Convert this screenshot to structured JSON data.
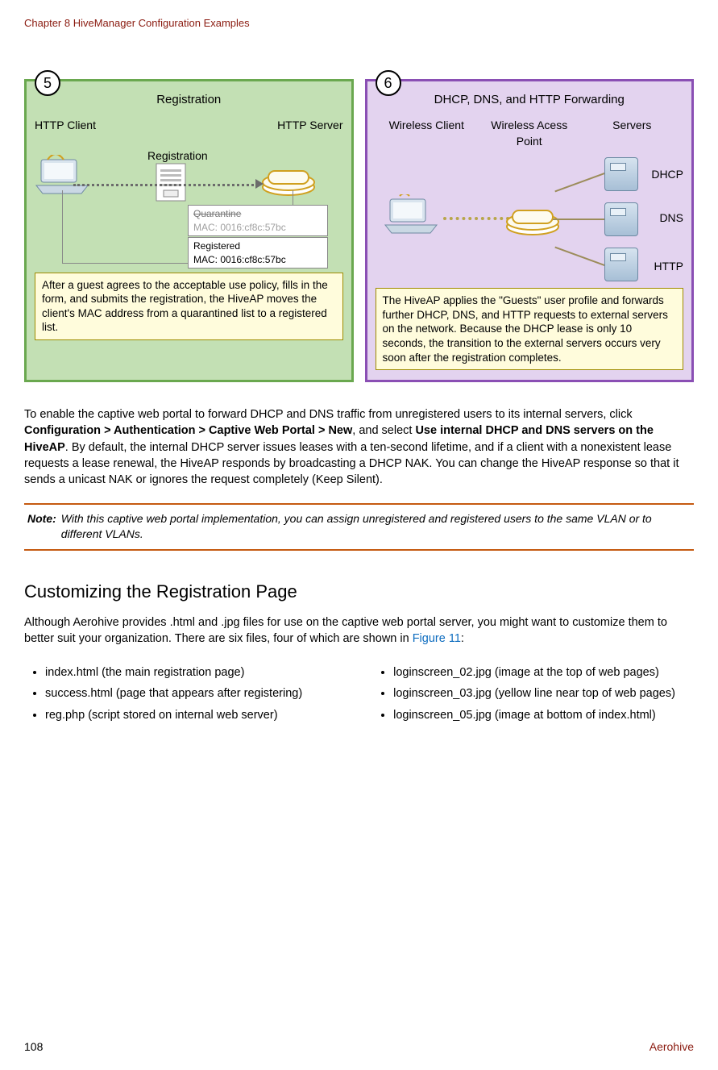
{
  "header": {
    "chapter": "Chapter 8 HiveManager Configuration Examples"
  },
  "diagram5": {
    "step": "5",
    "title": "Registration",
    "leftLabel": "HTTP Client",
    "rightLabel": "HTTP Server",
    "regLabel": "Registration",
    "quarantine": {
      "label": "Quarantine",
      "mac": "MAC: 0016:cf8c:57bc"
    },
    "registered": {
      "label": "Registered",
      "mac": "MAC: 0016:cf8c:57bc"
    },
    "desc": "After a guest agrees to the acceptable use policy, fills in the form, and submits the registration, the HiveAP moves the client's MAC address from a quarantined list to a registered list."
  },
  "diagram6": {
    "step": "6",
    "title": "DHCP, DNS, and HTTP Forwarding",
    "col1": "Wireless Client",
    "col2": "Wireless Acess Point",
    "col3": "Servers",
    "s1": "DHCP",
    "s2": "DNS",
    "s3": "HTTP",
    "desc": "The HiveAP applies the \"Guests\" user profile and forwards further DHCP, DNS, and HTTP requests to external servers on the network. Because the DHCP lease is only 10 seconds, the transition to the external servers occurs very soon after the registration completes."
  },
  "para": {
    "p1a": "To enable the captive web portal to forward DHCP and DNS traffic from unregistered users to its internal servers, click ",
    "p1b": "Configuration > Authentication > Captive Web Portal > New",
    "p1c": ", and select ",
    "p1d": "Use internal DHCP and DNS servers on the HiveAP",
    "p1e": ". By default, the internal DHCP server issues leases with a ten-second lifetime, and if a client with a nonexistent lease requests a lease renewal, the HiveAP responds by broadcasting a DHCP NAK. You can change the HiveAP response so that it sends a unicast NAK or ignores the request completely (Keep Silent)."
  },
  "note": {
    "label": "Note:",
    "text": "With this captive web portal implementation, you can assign unregistered and registered users to the same VLAN or to different VLANs."
  },
  "section": {
    "heading": "Customizing the Registration Page",
    "intro_a": "Although Aerohive provides .html and .jpg files for use on the captive web portal server, you might want to customize them to better suit your organization. There are six files, four of which are shown in ",
    "intro_link": "Figure 11",
    "intro_b": ":"
  },
  "lists": {
    "left": [
      "index.html (the main registration page)",
      "success.html (page that appears after registering)",
      "reg.php (script stored on internal web server)"
    ],
    "right": [
      "loginscreen_02.jpg (image at the top of web pages)",
      "loginscreen_03.jpg (yellow line near top of web pages)",
      "loginscreen_05.jpg (image at bottom of index.html)"
    ]
  },
  "footer": {
    "page": "108",
    "brand": "Aerohive"
  }
}
